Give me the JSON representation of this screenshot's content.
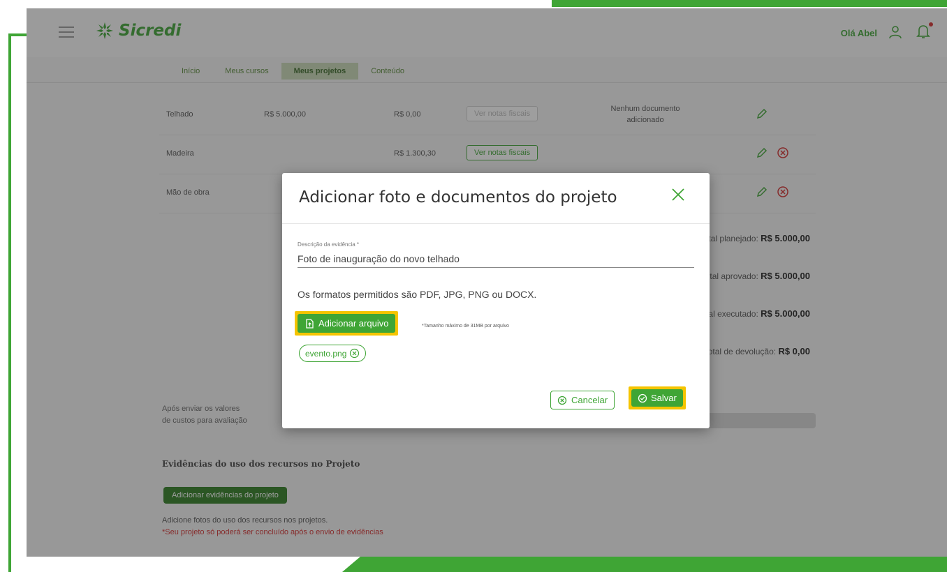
{
  "colors": {
    "brand": "#3fa535",
    "highlight": "#f5c400",
    "danger": "#d32f2f"
  },
  "header": {
    "logo_text": "Sicredi",
    "greeting": "Olá Abel",
    "tabs": [
      "Início",
      "Meus cursos",
      "Meus projetos",
      "Conteúdo"
    ],
    "active_tab": "Meus projetos"
  },
  "table": {
    "rows": [
      {
        "item": "Telhado",
        "value1": "R$ 5.000,00",
        "value2": "R$ 0,00",
        "action": "Ver notas fiscais",
        "status": "Nenhum documento adicionado"
      },
      {
        "item": "Madeira",
        "value1": "",
        "value2": "R$ 1.300,30",
        "action": "Ver notas fiscais",
        "status": ""
      },
      {
        "item": "Mão de obra",
        "value1": "",
        "value2": "",
        "action": "",
        "status": ""
      }
    ]
  },
  "totals": [
    {
      "label": "Total planejado:",
      "value": "R$ 5.000,00"
    },
    {
      "label": "Total aprovado:",
      "value": "R$ 5.000,00"
    },
    {
      "label": "Total executado:",
      "value": "R$ 5.000,00"
    },
    {
      "label": "Total de devolução:",
      "value": "R$ 0,00"
    }
  ],
  "bottom": {
    "paragraph_line1": "Após enviar os valores",
    "paragraph_line2": "de custos para avaliação",
    "heading": "Evidências do uso dos recursos no Projeto",
    "add_evidence_button": "Adicionar evidências do projeto",
    "note": "Adicione fotos do uso dos recursos nos projetos.",
    "warning": "*Seu projeto só poderá ser concluído após o envio de evidências"
  },
  "modal": {
    "title": "Adicionar foto e documentos do projeto",
    "field_label": "Descrição da evidência *",
    "field_value": "Foto de inauguração do novo telhado",
    "formats_text": "Os formatos permitidos são PDF, JPG, PNG ou DOCX.",
    "add_file_button": "Adicionar arquivo",
    "size_note": "*Tamanho máximo de 31MB por arquivo",
    "file_chip": "evento.png",
    "cancel_button": "Cancelar",
    "save_button": "Salvar"
  }
}
